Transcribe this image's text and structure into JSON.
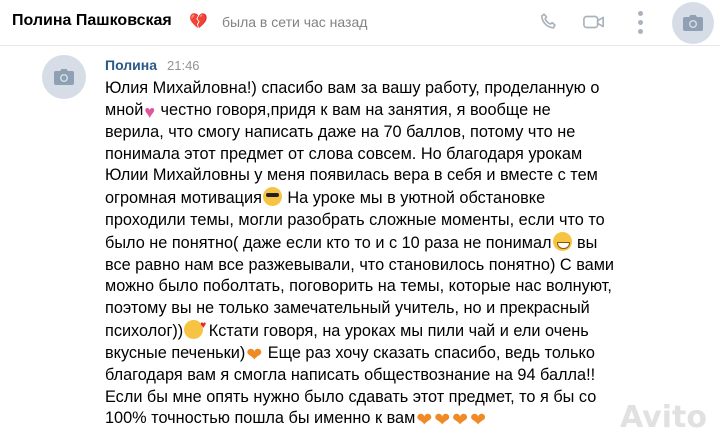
{
  "header": {
    "contact_name": "Полина Пашковская",
    "status": "была в сети час назад",
    "name_heart_icon": "broken-heart-icon",
    "phone_icon": "phone-icon",
    "video_icon": "video-camera-icon",
    "more_icon": "more-vertical-icon",
    "avatar_icon": "camera-icon"
  },
  "message": {
    "author": "Полина",
    "time": "21:46",
    "lines": [
      "Юлия Михайловна!) спасибо вам за вашу работу, проделанную о",
      [
        "мной",
        "💘",
        " честно говоря,придя к вам на занятия, я вообще не"
      ],
      "верила, что смогу написать даже на 70 баллов, потому что не",
      "понимала этот предмет от слова совсем. Но благодаря урокам",
      "Юлии Михайловны у меня появилась вера в себя и вместе с тем",
      [
        "огромная мотивация",
        "😎",
        " На уроке мы в уютной обстановке"
      ],
      "проходили темы, могли разобрать сложные моменты, если что то",
      [
        "было не понятно( даже если кто то и с 10 раза не понимал",
        "😁",
        " вы"
      ],
      "все равно нам все разжевывали, что становилось понятно) С вами",
      "можно было поболтать, поговорить на темы, которые нас волнуют,",
      "поэтому вы не только замечательный учитель, но и прекрасный",
      [
        "психолог))",
        "🥰",
        " Кстати говоря, на уроках мы пили чай и ели очень"
      ],
      [
        "вкусные печеньки)",
        "🧡",
        " Еще раз хочу сказать спасибо, ведь только"
      ],
      "благодаря вам я смогла написать обществознание на 94 балла!!",
      "Если бы мне опять нужно было сдавать этот предмет, то я бы со",
      [
        "100% точностью пошла бы именно к вам",
        "🧡🧡🧡🧡"
      ]
    ]
  },
  "watermark": "Avito",
  "colors": {
    "author": "#2a5885",
    "muted": "#828282",
    "heart_orange": "#f08a24",
    "heart_pink": "#e0569b"
  }
}
